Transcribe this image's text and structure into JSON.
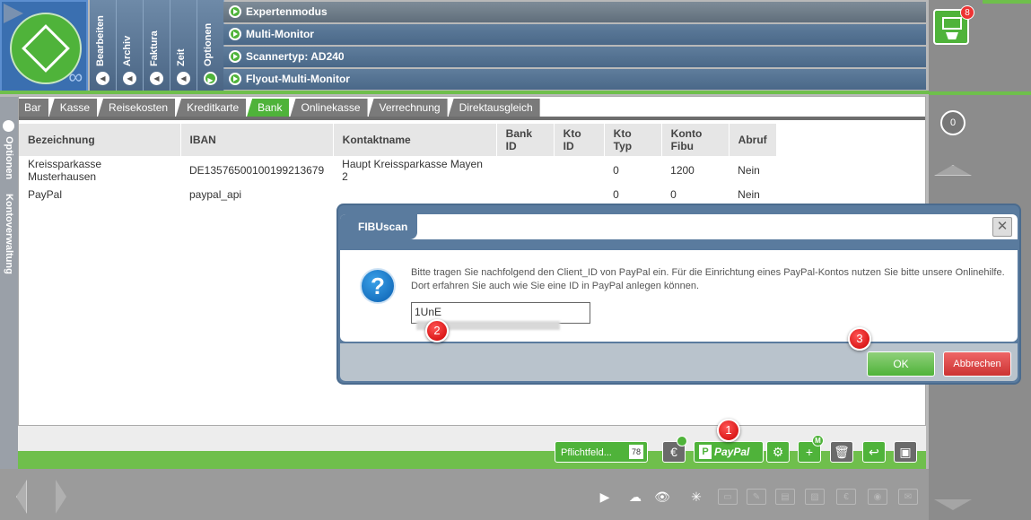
{
  "left_menu": [
    "Bearbeiten",
    "Archiv",
    "Faktura",
    "Zeit",
    "Optionen"
  ],
  "top_menu": [
    "Expertenmodus",
    "Multi-Monitor",
    "Scannertyp: AD240",
    "Flyout-Multi-Monitor"
  ],
  "side_tab": {
    "label1": "Optionen",
    "label2": "Kontoverwaltung"
  },
  "tabs": [
    "Bar",
    "Kasse",
    "Reisekosten",
    "Kreditkarte",
    "Bank",
    "Onlinekasse",
    "Verrechnung",
    "Direktausgleich"
  ],
  "active_tab": "Bank",
  "table": {
    "headers": [
      "Bezeichnung",
      "IBAN",
      "Kontaktname",
      "Bank ID",
      "Kto ID",
      "Kto Typ",
      "Konto Fibu",
      "Abruf"
    ],
    "rows": [
      [
        "Kreissparkasse Musterhausen",
        "DE13576500100199213679",
        "Haupt Kreissparkasse Mayen 2",
        "",
        "",
        "0",
        "1200",
        "Nein"
      ],
      [
        "PayPal",
        "paypal_api",
        "",
        "",
        "",
        "0",
        "0",
        "Nein"
      ]
    ]
  },
  "toolbar": {
    "pflicht_label": "Pflichtfeld...",
    "pflicht_num": "78",
    "paypal_label": "PayPal",
    "paypal_p": "P",
    "m_badge": "M",
    "euro": "€"
  },
  "right": {
    "mail_badge": "8",
    "zero": "0"
  },
  "dialog": {
    "title": "FIBUscan",
    "message": "Bitte tragen Sie nachfolgend den Client_ID von PayPal ein. Für die Einrichtung eines PayPal-Kontos nutzen Sie bitte unsere Onlinehilfe. Dort erfahren Sie auch wie Sie eine ID in PayPal anlegen können.",
    "input_value": "1UnE",
    "ok_label": "OK",
    "cancel_label": "Abbrechen",
    "close_symbol": "✕"
  },
  "callouts": [
    "1",
    "2",
    "3"
  ],
  "colors": {
    "accent_green": "#4fb33a",
    "menu_blue": "#4a6888",
    "callout_red": "#cc0000"
  }
}
